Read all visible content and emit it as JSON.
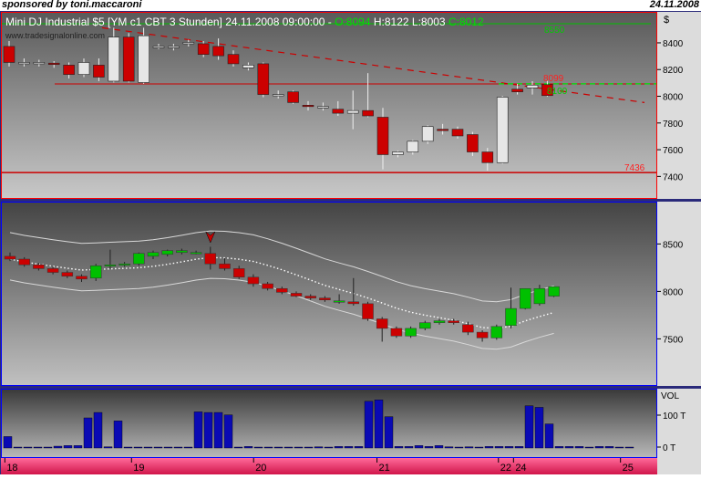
{
  "top_left": "sponsored by toni.maccaroni",
  "top_right": "24.11.2008",
  "header": {
    "instrument": "Mini DJ Industrial $5 [YM c1 CBT  3 Stunden]",
    "datetime": "24.11.2008 09:00:00",
    "sep": " - ",
    "open": "O:8094",
    "high": "H:8122",
    "low": "L:8003",
    "close": "C:8012"
  },
  "watermark": "www.tradesignalonline.com",
  "colors": {
    "bull_price": "#e6e6e6",
    "bear_price": "#cc0000",
    "bull_ind": "#00c000",
    "bear_ind": "#cc0000",
    "volume": "#0a0ab4",
    "resistance": "#cc0000",
    "support": "#00aa00"
  },
  "chart_data": [
    {
      "type": "candlestick",
      "title": "Mini DJ Industrial $5 [YM c1 CBT  3 Stunden]",
      "ylabel": "$",
      "ylim": [
        7300,
        8550
      ],
      "yticks": [
        7400,
        7600,
        7800,
        8000,
        8200,
        8400
      ],
      "ohlc": [
        [
          8380,
          8420,
          8230,
          8260
        ],
        [
          8250,
          8290,
          8230,
          8260
        ],
        [
          8250,
          8280,
          8230,
          8260
        ],
        [
          8255,
          8270,
          8220,
          8250
        ],
        [
          8240,
          8260,
          8140,
          8170
        ],
        [
          8170,
          8290,
          8150,
          8260
        ],
        [
          8240,
          8290,
          8120,
          8150
        ],
        [
          8120,
          8520,
          8110,
          8450
        ],
        [
          8450,
          8480,
          8110,
          8120
        ],
        [
          8110,
          8520,
          8100,
          8460
        ],
        [
          8370,
          8400,
          8360,
          8380
        ],
        [
          8370,
          8400,
          8350,
          8380
        ],
        [
          8400,
          8430,
          8380,
          8410
        ],
        [
          8400,
          8420,
          8300,
          8320
        ],
        [
          8380,
          8440,
          8280,
          8310
        ],
        [
          8320,
          8350,
          8230,
          8250
        ],
        [
          8220,
          8260,
          8200,
          8240
        ],
        [
          8250,
          8260,
          8000,
          8020
        ],
        [
          8010,
          8050,
          7990,
          8020
        ],
        [
          8040,
          8050,
          7950,
          7960
        ],
        [
          7940,
          7970,
          7900,
          7930
        ],
        [
          7930,
          7960,
          7900,
          7930
        ],
        [
          7910,
          7970,
          7860,
          7880
        ],
        [
          7880,
          8050,
          7760,
          7900
        ],
        [
          7900,
          8180,
          7850,
          7860
        ],
        [
          7850,
          7920,
          7460,
          7570
        ],
        [
          7570,
          7600,
          7550,
          7590
        ],
        [
          7590,
          7680,
          7570,
          7670
        ],
        [
          7670,
          7790,
          7650,
          7780
        ],
        [
          7760,
          7800,
          7720,
          7750
        ],
        [
          7760,
          7780,
          7690,
          7710
        ],
        [
          7720,
          7740,
          7560,
          7590
        ],
        [
          7590,
          7620,
          7450,
          7510
        ],
        [
          7510,
          8010,
          7500,
          8000
        ],
        [
          8060,
          8100,
          8020,
          8040
        ],
        [
          8070,
          8120,
          8020,
          8090
        ],
        [
          8094,
          8122,
          8003,
          8012
        ]
      ],
      "annotations": [
        {
          "label": "8550",
          "value": 8550,
          "color": "#00cc00"
        },
        {
          "label": "8099",
          "value": 8099,
          "color": "#ff2020"
        },
        {
          "label": "8100",
          "value": 8100,
          "color": "#00cc00"
        },
        {
          "label": "7436",
          "value": 7436,
          "color": "#ff2020"
        }
      ]
    },
    {
      "type": "candlestick",
      "ylim": [
        7100,
        8850
      ],
      "yticks": [
        7500,
        8000,
        8500
      ],
      "signal_bar_index": 14,
      "ohlc": [
        [
          8380,
          8420,
          8330,
          8350
        ],
        [
          8350,
          8370,
          8270,
          8290
        ],
        [
          8290,
          8310,
          8230,
          8250
        ],
        [
          8250,
          8270,
          8190,
          8210
        ],
        [
          8210,
          8230,
          8150,
          8170
        ],
        [
          8170,
          8190,
          8110,
          8140
        ],
        [
          8150,
          8300,
          8120,
          8280
        ],
        [
          8280,
          8450,
          8250,
          8290
        ],
        [
          8290,
          8320,
          8270,
          8300
        ],
        [
          8300,
          8420,
          8280,
          8410
        ],
        [
          8380,
          8440,
          8350,
          8420
        ],
        [
          8400,
          8450,
          8380,
          8440
        ],
        [
          8420,
          8460,
          8400,
          8440
        ],
        [
          8410,
          8440,
          8400,
          8420
        ],
        [
          8410,
          8480,
          8240,
          8300
        ],
        [
          8300,
          8360,
          8230,
          8250
        ],
        [
          8250,
          8280,
          8140,
          8160
        ],
        [
          8160,
          8190,
          8060,
          8090
        ],
        [
          8090,
          8110,
          8020,
          8040
        ],
        [
          8040,
          8060,
          7980,
          8000
        ],
        [
          7990,
          8010,
          7950,
          7960
        ],
        [
          7960,
          7980,
          7920,
          7940
        ],
        [
          7940,
          7960,
          7900,
          7920
        ],
        [
          7900,
          7980,
          7880,
          7910
        ],
        [
          7900,
          8150,
          7860,
          7880
        ],
        [
          7880,
          7900,
          7700,
          7720
        ],
        [
          7720,
          7740,
          7480,
          7620
        ],
        [
          7620,
          7640,
          7520,
          7540
        ],
        [
          7540,
          7640,
          7520,
          7620
        ],
        [
          7620,
          7700,
          7600,
          7680
        ],
        [
          7680,
          7720,
          7660,
          7700
        ],
        [
          7700,
          7720,
          7660,
          7680
        ],
        [
          7660,
          7690,
          7550,
          7580
        ],
        [
          7580,
          7600,
          7480,
          7520
        ],
        [
          7520,
          7660,
          7500,
          7640
        ],
        [
          7650,
          8050,
          7620,
          7830
        ],
        [
          7830,
          8040,
          7820,
          8040
        ],
        [
          7880,
          8080,
          7860,
          8040
        ],
        [
          7960,
          8060,
          7950,
          8060
        ]
      ]
    },
    {
      "type": "bar",
      "ylabel": "VOL",
      "ytick_labels": [
        "100 T",
        "0 T"
      ],
      "values": [
        38,
        3,
        3,
        3,
        3,
        6,
        8,
        8,
        100,
        118,
        4,
        90,
        3,
        3,
        3,
        3,
        3,
        3,
        3,
        120,
        118,
        118,
        110,
        3,
        5,
        3,
        3,
        3,
        3,
        3,
        3,
        4,
        3,
        5,
        5,
        5,
        155,
        160,
        104,
        5,
        5,
        8,
        5,
        8,
        4,
        3,
        4,
        3,
        5,
        5,
        5,
        5,
        140,
        135,
        80,
        5,
        5,
        5,
        3,
        5,
        5,
        3,
        3
      ]
    }
  ],
  "xaxis": {
    "labels": [
      {
        "text": "18",
        "frac": 0.006
      },
      {
        "text": "19",
        "frac": 0.199
      },
      {
        "text": "20",
        "frac": 0.385
      },
      {
        "text": "21",
        "frac": 0.573
      },
      {
        "text": "22",
        "frac": 0.758
      },
      {
        "text": "24",
        "frac": 0.781
      },
      {
        "text": "25",
        "frac": 0.944
      }
    ]
  }
}
